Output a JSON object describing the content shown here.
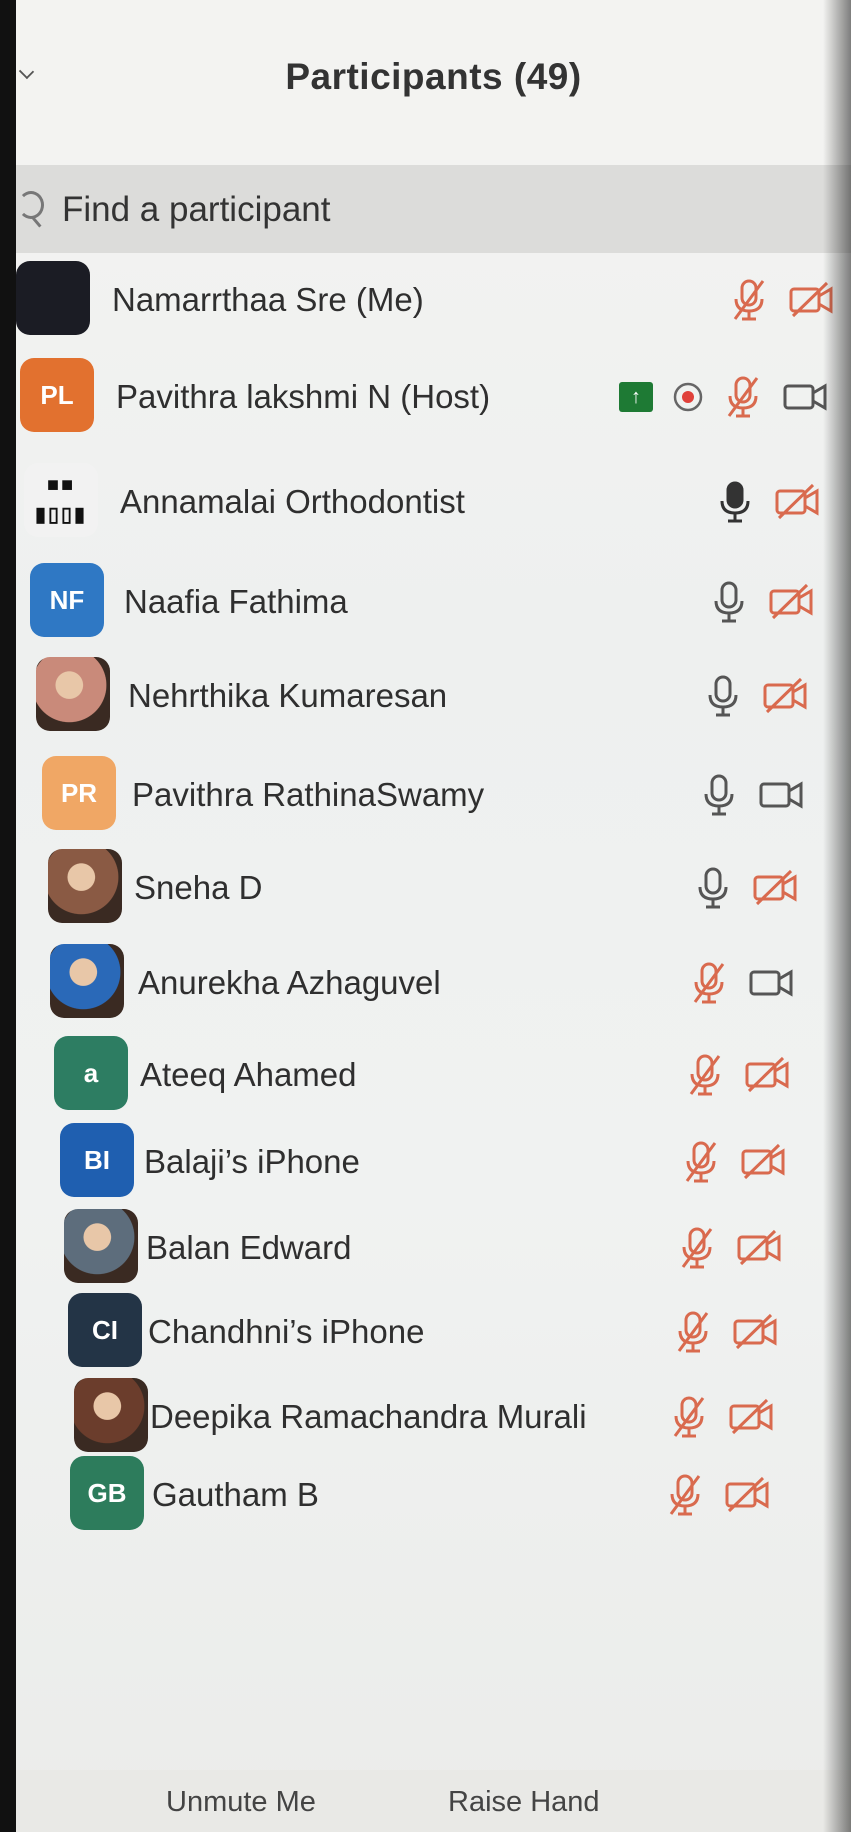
{
  "header": {
    "title": "Participants (49)"
  },
  "search": {
    "placeholder": "Find a participant"
  },
  "participants": [
    {
      "name": "Namarrthaa Sre (Me)",
      "initials": "",
      "avatar_color": "#1b1c24",
      "mic": "muted",
      "video": "off"
    },
    {
      "name": "Pavithra lakshmi N (Host)",
      "initials": "PL",
      "avatar_color": "#e2712f",
      "mic": "muted",
      "video": "on",
      "sharing_badge": "↑",
      "recording_icon": "record-icon"
    },
    {
      "name": "Annamalai Orthodontist",
      "initials": "",
      "avatar_color": "#f2f2f2",
      "avatar_kind": "logo",
      "mic": "active",
      "video": "off"
    },
    {
      "name": "Naafia Fathima",
      "initials": "NF",
      "avatar_color": "#2f78c4",
      "mic": "unmuted",
      "video": "off"
    },
    {
      "name": "Nehrthika Kumaresan",
      "initials": "",
      "avatar_color": "#c98a7a",
      "avatar_kind": "photo",
      "mic": "unmuted",
      "video": "off"
    },
    {
      "name": "Pavithra RathinaSwamy",
      "initials": "PR",
      "avatar_color": "#f0a765",
      "mic": "unmuted",
      "video": "on"
    },
    {
      "name": "Sneha D",
      "initials": "",
      "avatar_color": "#8a5a44",
      "avatar_kind": "photo",
      "mic": "unmuted",
      "video": "off"
    },
    {
      "name": "Anurekha Azhaguvel",
      "initials": "",
      "avatar_color": "#2a69b8",
      "avatar_kind": "photo",
      "mic": "muted",
      "video": "on"
    },
    {
      "name": "Ateeq Ahamed",
      "initials": "a",
      "avatar_color": "#2d7d62",
      "mic": "muted",
      "video": "off"
    },
    {
      "name": "Balaji’s iPhone",
      "initials": "BI",
      "avatar_color": "#1f5fb0",
      "mic": "muted",
      "video": "off"
    },
    {
      "name": "Balan Edward",
      "initials": "",
      "avatar_color": "#5d6d7c",
      "avatar_kind": "photo",
      "mic": "muted",
      "video": "off"
    },
    {
      "name": "Chandhni’s iPhone",
      "initials": "CI",
      "avatar_color": "#233446",
      "mic": "muted",
      "video": "off"
    },
    {
      "name": "Deepika Ramachandra Murali",
      "initials": "",
      "avatar_color": "#6b3d2c",
      "avatar_kind": "photo",
      "mic": "muted",
      "video": "off"
    },
    {
      "name": "Gautham B",
      "initials": "GB",
      "avatar_color": "#2d7c5c",
      "mic": "muted",
      "video": "off"
    }
  ],
  "footer": {
    "unmute_label": "Unmute Me",
    "raise_hand_label": "Raise Hand"
  },
  "colors": {
    "muted_red": "#d96a4e",
    "icon_gray": "#555555"
  }
}
